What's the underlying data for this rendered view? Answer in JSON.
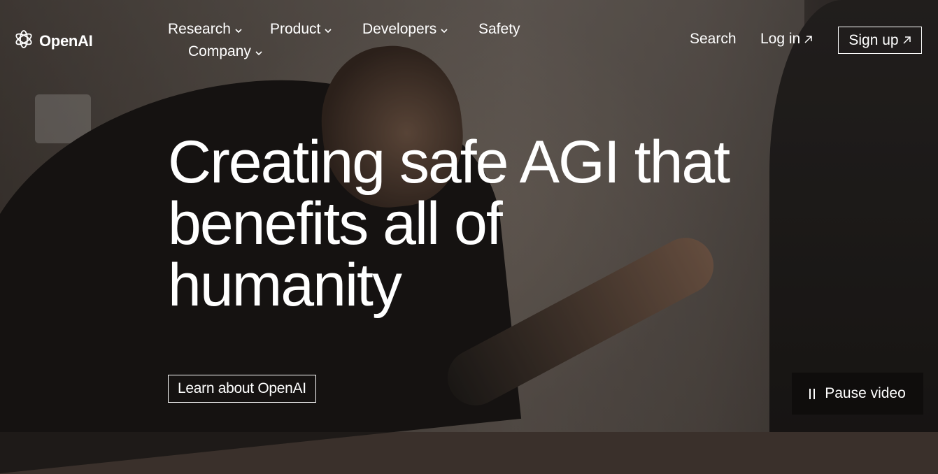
{
  "brand": {
    "name": "OpenAI",
    "icon": "openai-logo-icon"
  },
  "nav": {
    "items": [
      {
        "label": "Research",
        "has_dropdown": true
      },
      {
        "label": "Product",
        "has_dropdown": true
      },
      {
        "label": "Developers",
        "has_dropdown": true
      },
      {
        "label": "Safety",
        "has_dropdown": false
      },
      {
        "label": "Company",
        "has_dropdown": true
      }
    ]
  },
  "header": {
    "search_label": "Search",
    "login_label": "Log in",
    "signup_label": "Sign up"
  },
  "hero": {
    "title_line1": "Creating safe AGI that",
    "title_line2": "benefits all of",
    "title_line3": "humanity",
    "cta_label": "Learn about OpenAI"
  },
  "video": {
    "pause_label": "Pause video",
    "icon": "pause-icon"
  }
}
